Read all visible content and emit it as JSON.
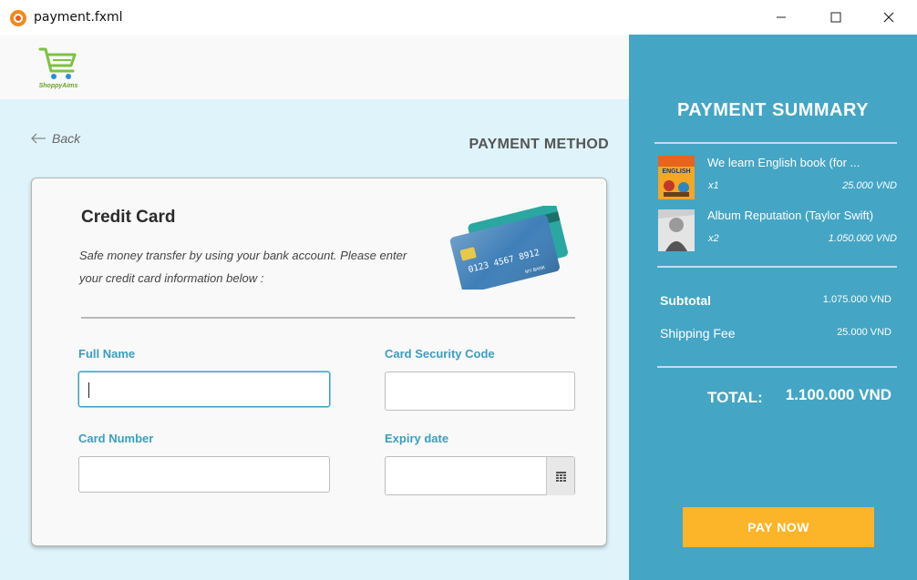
{
  "window": {
    "title": "payment.fxml",
    "icon": "app-icon"
  },
  "logo": {
    "text": "ShoppyAims",
    "icon": "shopping-cart-icon"
  },
  "nav": {
    "back_label": "Back"
  },
  "page": {
    "title": "PAYMENT METHOD"
  },
  "card": {
    "title": "Credit Card",
    "description": "Safe money transfer by using your bank account. Please enter your credit card information below :",
    "image_text": {
      "number": "0123 4567 8912",
      "bank": "MY BANK"
    }
  },
  "form": {
    "full_name": {
      "label": "Full Name",
      "value": ""
    },
    "security_code": {
      "label": "Card Security Code",
      "value": ""
    },
    "card_number": {
      "label": "Card Number",
      "value": ""
    },
    "expiry_date": {
      "label": "Expiry date",
      "value": ""
    }
  },
  "summary": {
    "title": "PAYMENT SUMMARY",
    "items": [
      {
        "name": "We learn English book (for ...",
        "qty": "x1",
        "price": "25.000 VND",
        "thumb_text": "ENGLISH"
      },
      {
        "name": "Album Reputation (Taylor Swift)",
        "qty": "x2",
        "price": "1.050.000 VND"
      }
    ],
    "subtotal_label": "Subtotal",
    "subtotal_value": "1.075.000 VND",
    "shipping_label": "Shipping Fee",
    "shipping_value": "25.000 VND",
    "total_label": "TOTAL:",
    "total_value": "1.100.000 VND",
    "pay_button": "PAY NOW"
  },
  "colors": {
    "accent": "#44a5c5",
    "pay_button": "#fcb428",
    "label_blue": "#3a9fc0",
    "left_bg": "#dff4fa"
  }
}
